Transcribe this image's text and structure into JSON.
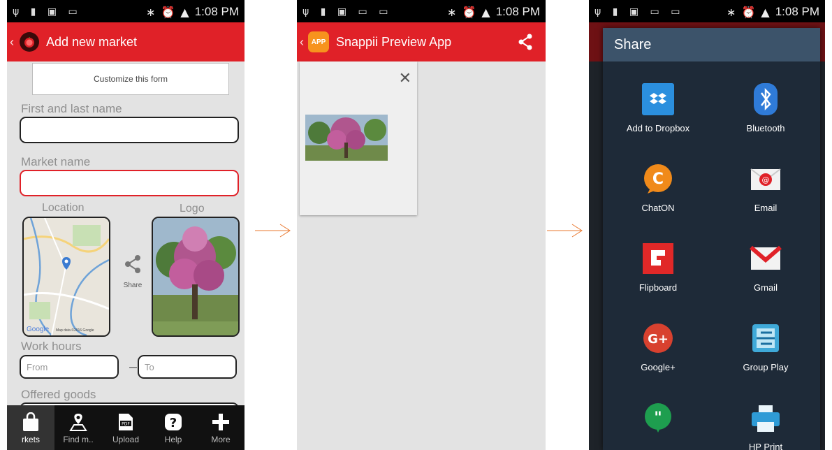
{
  "status_bar": {
    "time": "1:08 PM"
  },
  "screen1": {
    "title": "Add new market",
    "customize_label": "Customize this form",
    "fields": {
      "name_label": "First and last name",
      "market_label": "Market name",
      "location_label": "Location",
      "logo_label": "Logo",
      "share_label": "Share",
      "work_hours_label": "Work hours",
      "from_placeholder": "From",
      "to_placeholder": "To",
      "offered_goods_label": "Offered goods",
      "range_separator": "–"
    },
    "map_credit": "Google",
    "map_data": "Map data ©2016 Google",
    "tabs": [
      {
        "label": "rkets",
        "icon": "shopping-bag-icon"
      },
      {
        "label": "Find m..",
        "icon": "map-pin-icon"
      },
      {
        "label": "Upload",
        "icon": "pdf-icon"
      },
      {
        "label": "Help",
        "icon": "help-icon"
      },
      {
        "label": "More",
        "icon": "plus-icon"
      }
    ]
  },
  "screen2": {
    "title": "Snappii Preview App",
    "app_icon_text": "APP",
    "close_glyph": "✕"
  },
  "screen3": {
    "title": "Share",
    "items": [
      {
        "label": "Add to Dropbox",
        "icon": "dropbox-icon"
      },
      {
        "label": "Bluetooth",
        "icon": "bluetooth-icon"
      },
      {
        "label": "ChatON",
        "icon": "chaton-icon"
      },
      {
        "label": "Email",
        "icon": "email-icon"
      },
      {
        "label": "Flipboard",
        "icon": "flipboard-icon"
      },
      {
        "label": "Gmail",
        "icon": "gmail-icon"
      },
      {
        "label": "Google+",
        "icon": "google-plus-icon"
      },
      {
        "label": "Group Play",
        "icon": "group-play-icon"
      },
      {
        "label": "",
        "icon": "hangouts-icon"
      },
      {
        "label": "HP Print",
        "icon": "hp-print-icon"
      }
    ]
  },
  "colors": {
    "accent": "#e02128",
    "sheet_bg": "#1e2a38",
    "sheet_header": "#3c536a",
    "arrow": "#e8772e"
  }
}
